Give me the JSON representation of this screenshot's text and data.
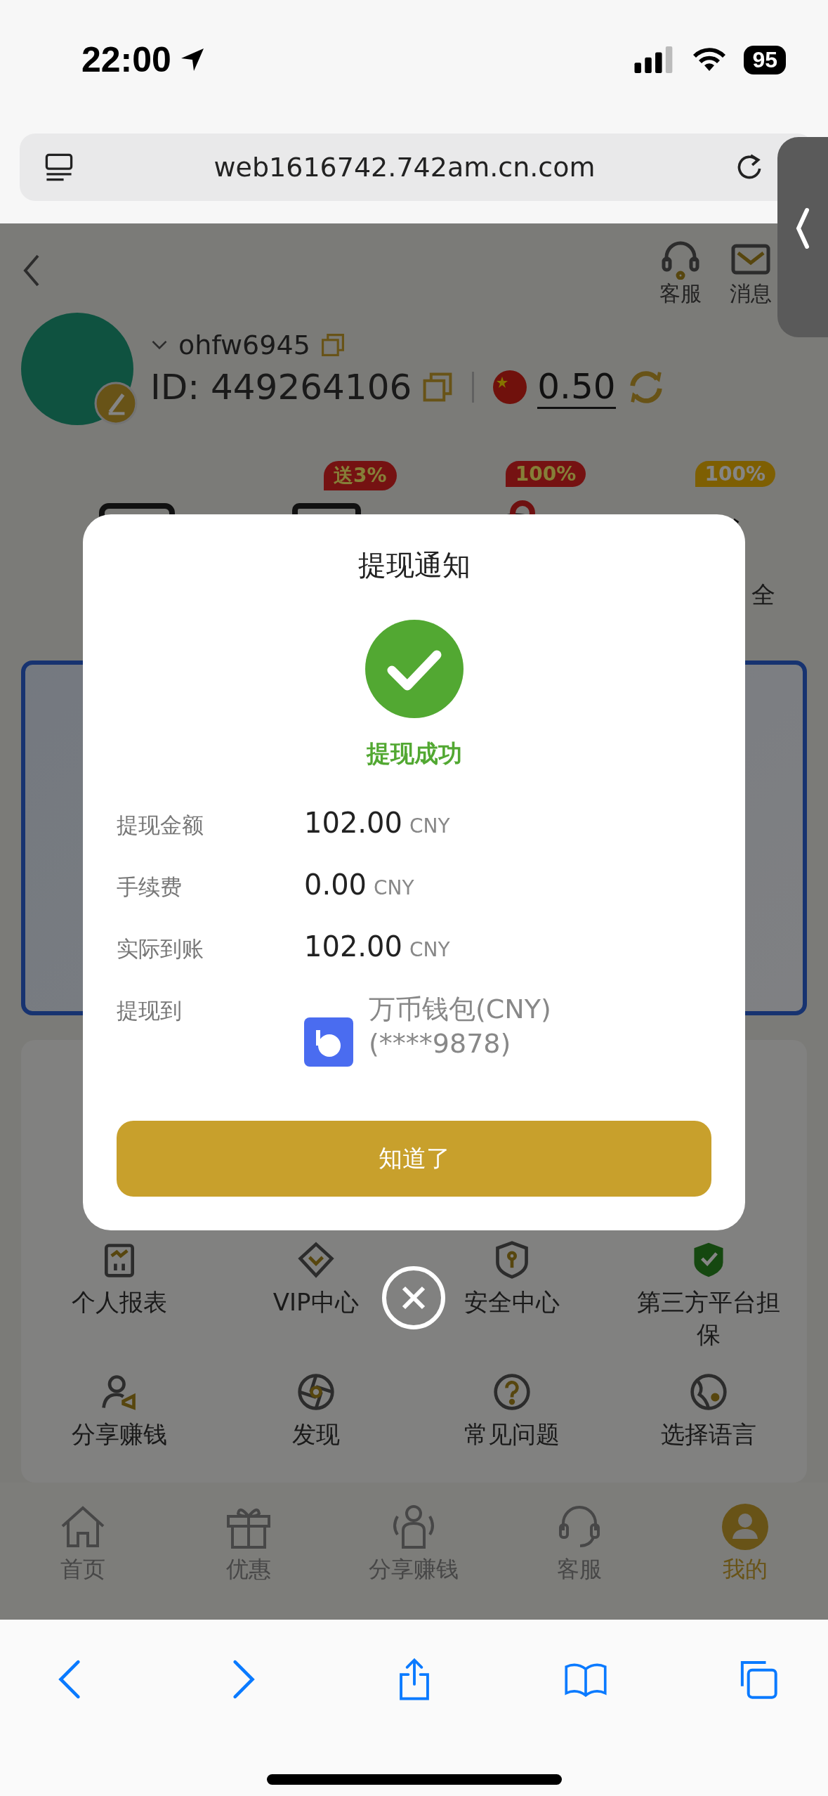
{
  "status_bar": {
    "time": "22:00",
    "battery": "95"
  },
  "browser": {
    "url": "web1616742.742am.cn.com"
  },
  "header": {
    "actions": [
      {
        "label": "客服"
      },
      {
        "label": "消息"
      }
    ]
  },
  "profile": {
    "username": "ohfw6945",
    "id": "ID: 449264106",
    "balance": "0.50"
  },
  "quick_actions": [
    {
      "kind": "card"
    },
    {
      "kind": "stack",
      "badge": "送3%"
    },
    {
      "kind": "piggy",
      "badge": "100%"
    },
    {
      "kind": "hands",
      "badge": "100%",
      "label": "全"
    }
  ],
  "menu": [
    {
      "label": "个人报表"
    },
    {
      "label": "VIP中心"
    },
    {
      "label": "安全中心"
    },
    {
      "label": "第三方平台担保"
    },
    {
      "label": "分享赚钱"
    },
    {
      "label": "发现"
    },
    {
      "label": "常见问题"
    },
    {
      "label": "选择语言"
    }
  ],
  "tab_bar": [
    {
      "label": "首页",
      "selected": false
    },
    {
      "label": "优惠",
      "selected": false
    },
    {
      "label": "分享赚钱",
      "selected": false
    },
    {
      "label": "客服",
      "selected": false
    },
    {
      "label": "我的",
      "selected": true
    }
  ],
  "dialog": {
    "title": "提现通知",
    "status": "提现成功",
    "rows": [
      {
        "kind": "amount",
        "label": "提现金额",
        "amount": "102.00",
        "currency": "CNY"
      },
      {
        "kind": "amount",
        "label": "手续费",
        "amount": "0.00",
        "currency": "CNY"
      },
      {
        "kind": "amount",
        "label": "实际到账",
        "amount": "102.00",
        "currency": "CNY"
      },
      {
        "kind": "wallet",
        "label": "提现到",
        "name": "万币钱包(CNY)",
        "account": "(****9878)"
      }
    ],
    "button": "知道了"
  }
}
